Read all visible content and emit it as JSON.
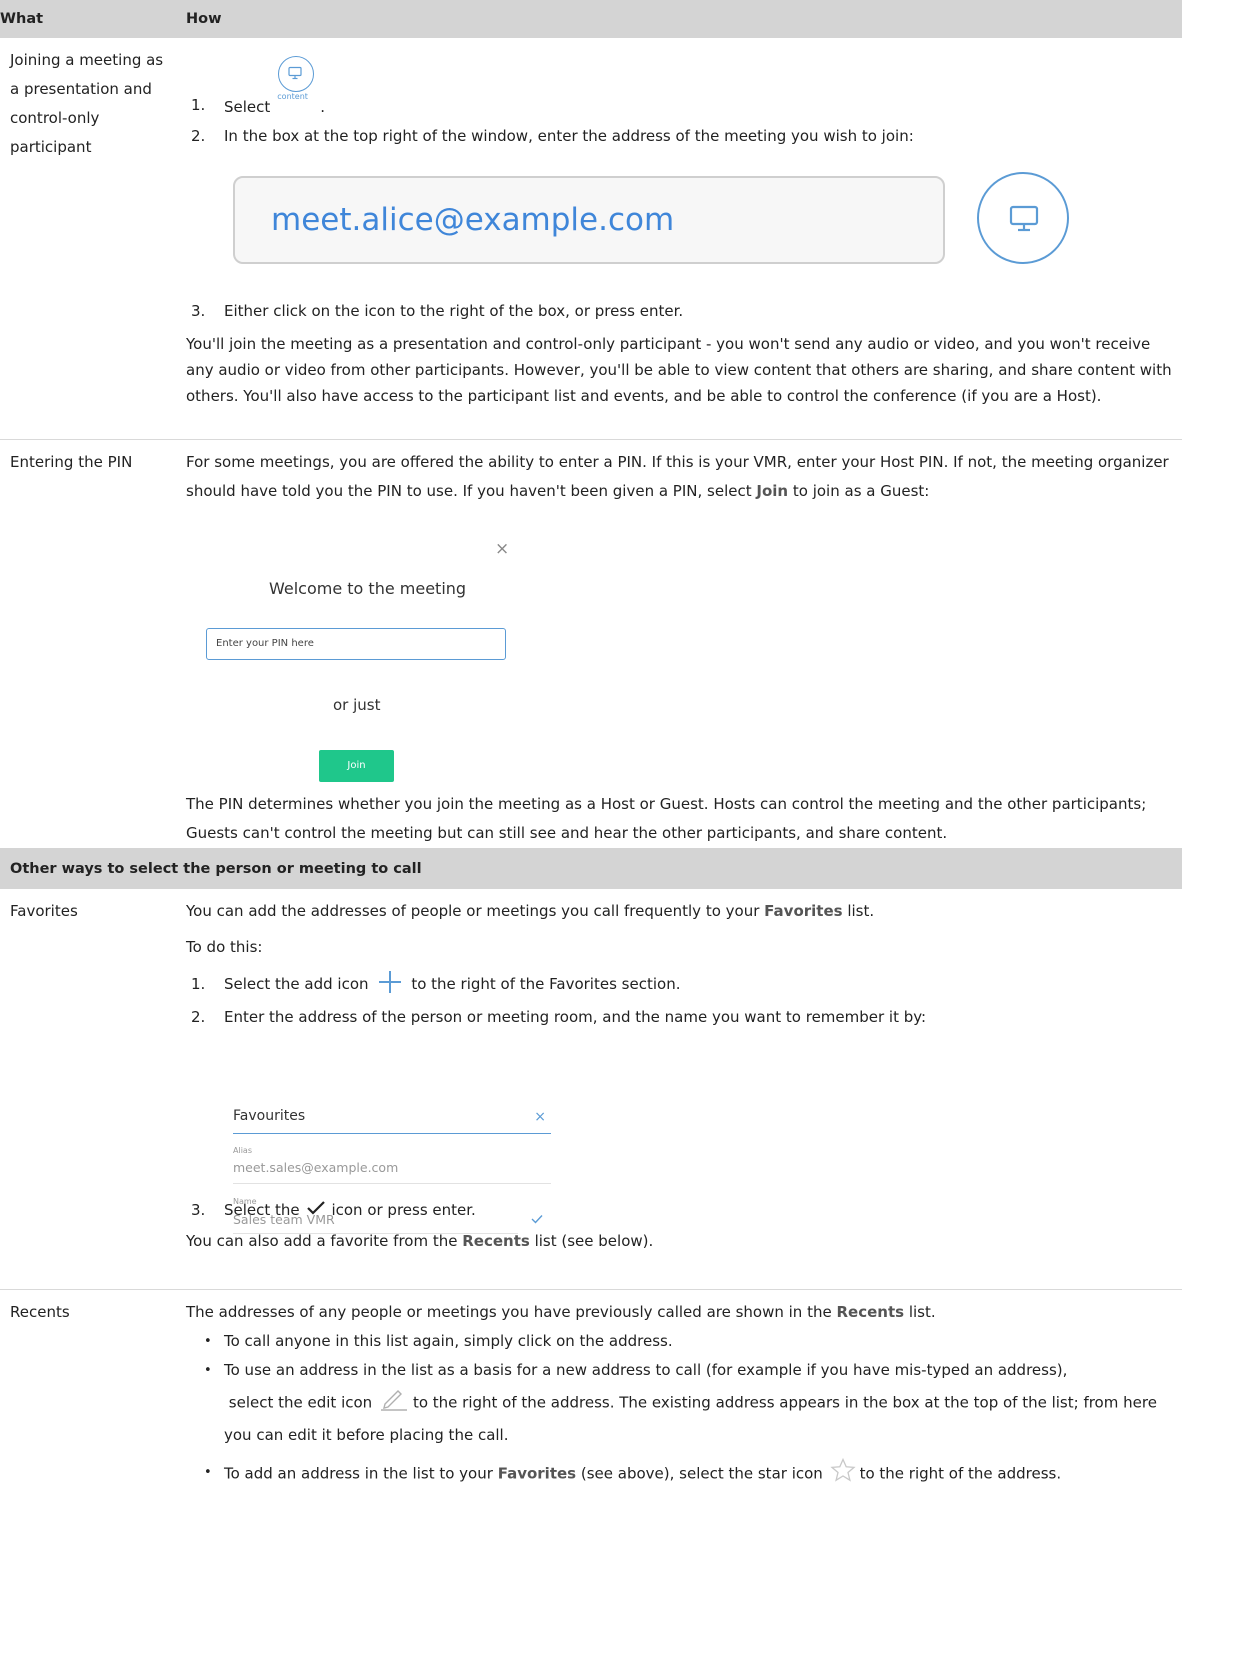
{
  "header": {
    "what": "What",
    "how": "How"
  },
  "rows": {
    "join": {
      "what": "Joining a meeting as a presentation and control-only participant",
      "step1_before": "Select",
      "step1_caption": "content",
      "step1_after": ".",
      "step2": "In the box at the top right of the window, enter the address of the meeting you wish to join:",
      "address_example": "meet.alice@example.com",
      "step3": "Either click on the icon to the right of the box, or press enter.",
      "paragraph": "You'll join the meeting as a presentation and control-only participant - you won't send any audio or video, and you won't receive any audio or video from other participants. However, you'll be able to view content that others are sharing, and share content with others. You'll also have access to the participant list and events, and be able to control the conference (if you are a Host)."
    },
    "pin": {
      "what": "Entering the PIN",
      "para1_before": "For some meetings, you are offered the ability to enter a PIN. If this is your VMR, enter your Host PIN. If not, the meeting organizer should have told you the PIN to use. If you haven't been given a PIN, select",
      "para1_bold": "Join",
      "para1_after": "to join as a Guest:",
      "dialog": {
        "close": "×",
        "title": "Welcome to the meeting",
        "input_placeholder": "Enter your PIN here",
        "or_just": "or just",
        "join_button": "Join"
      },
      "para2": "The PIN determines whether you join the meeting as a Host or Guest. Hosts can control the meeting and the other participants; Guests can't control the meeting but can still see and hear the other participants, and share content."
    },
    "section_title": "Other ways to select the person or meeting to call",
    "favorites": {
      "what": "Favorites",
      "para1_before": "You can add the addresses of people or meetings you call frequently to your",
      "para1_bold": "Favorites",
      "para1_after": "list.",
      "todo": "To do this:",
      "step1_before": "Select the add icon",
      "step1_after": "to the right of the Favorites section.",
      "step2": "Enter the address of the person or meeting room, and the name you want to remember it by:",
      "panel": {
        "title": "Favourites",
        "close": "×",
        "alias_label": "Alias",
        "alias_value": "meet.sales@example.com",
        "name_label": "Name",
        "name_value": "Sales team VMR"
      },
      "step3_before": "Select the",
      "step3_after": "icon or press enter.",
      "para2_before": "You can also add a favorite from the",
      "para2_bold": "Recents",
      "para2_after": "list (see below)."
    },
    "recents": {
      "what": "Recents",
      "para1_before": "The addresses of any people or meetings you have previously called are shown in the",
      "para1_bold": "Recents",
      "para1_after": "list.",
      "bullet1": "To call anyone in this list again, simply click on the address.",
      "bullet2_line1": "To use an address in the list as a basis for a new address to call (for example if you have mis-typed an address),",
      "bullet2_before": "select the edit icon",
      "bullet2_after": "to the right of the address. The existing address appears in the box at the top of the list; from here you can edit it before placing the call.",
      "bullet3_before": "To add an address in the list to your",
      "bullet3_bold": "Favorites",
      "bullet3_mid": "(see above), select the star icon",
      "bullet3_after": "to the right of the address."
    }
  },
  "colors": {
    "accent": "#5b9bd5",
    "join_green": "#1fc78b",
    "header_gray": "#d4d4d4"
  }
}
